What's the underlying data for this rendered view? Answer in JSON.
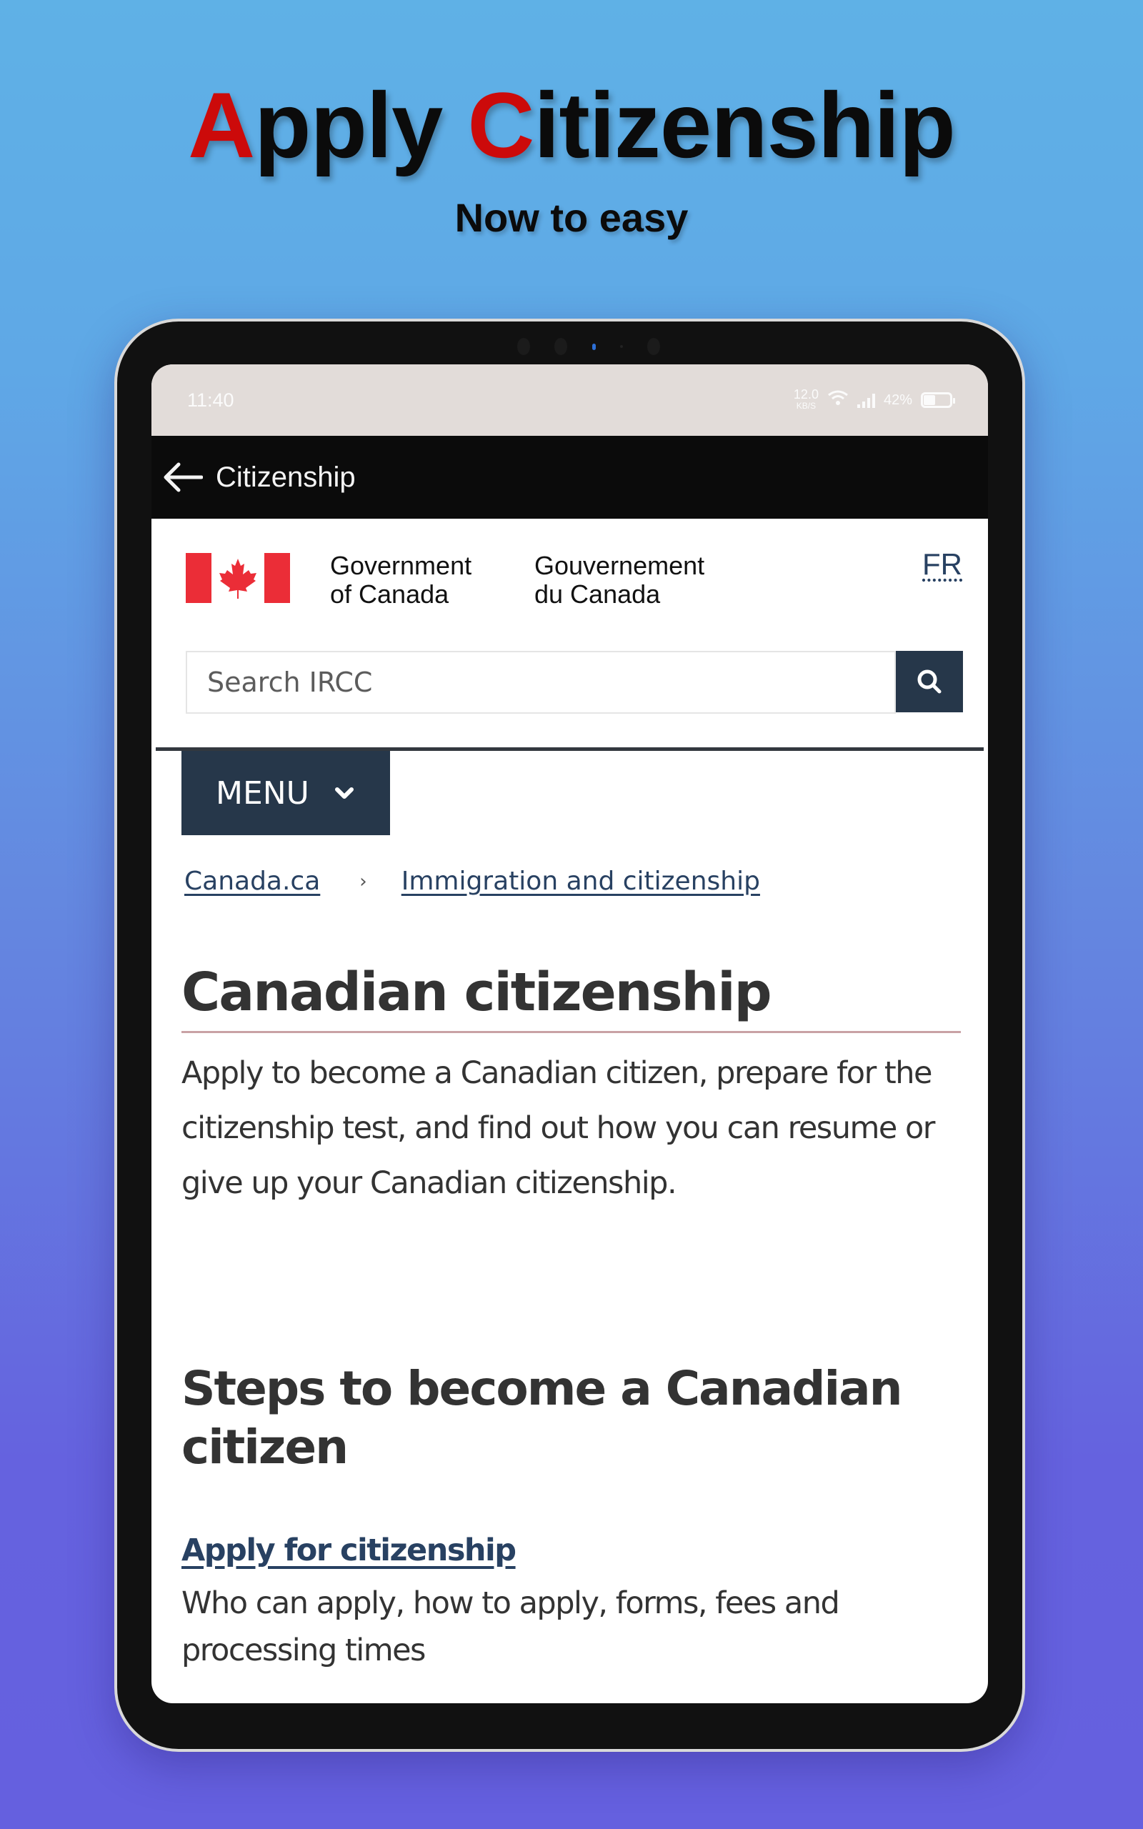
{
  "promo": {
    "title_parts": [
      {
        "text": "A",
        "accent": true
      },
      {
        "text": "pply ",
        "accent": false
      },
      {
        "text": "C",
        "accent": true
      },
      {
        "text": "itizenship",
        "accent": false
      }
    ],
    "subtitle": "Now to easy",
    "accent_color": "#cc0a0a"
  },
  "statusbar": {
    "time": "11:40",
    "net_speed": "12.0",
    "net_unit": "KB/S",
    "battery": "42%"
  },
  "appbar": {
    "back_icon": "arrow-left-icon",
    "title": "Citizenship"
  },
  "gc_header": {
    "en_line1": "Government",
    "en_line2": "of Canada",
    "fr_line1": "Gouvernement",
    "fr_line2": "du Canada",
    "language_toggle": "FR"
  },
  "search": {
    "placeholder": "Search IRCC",
    "value": "",
    "button_icon": "search-icon"
  },
  "menu": {
    "label": "MENU",
    "icon": "chevron-down-icon"
  },
  "breadcrumb": {
    "items": [
      "Canada.ca",
      "Immigration and citizenship"
    ],
    "separator": "›"
  },
  "page": {
    "title": "Canadian citizenship",
    "lead": "Apply to become a Canadian citizen, prepare for the citizenship test, and find out how you can resume or give up your Canadian citizenship.",
    "section_title": "Steps to become a Canadian citizen",
    "steps": [
      {
        "link": "Apply for citizenship",
        "description": "Who can apply, how to apply, forms, fees and processing times"
      }
    ]
  },
  "colors": {
    "gc_navy": "#26374a",
    "link": "#284162",
    "flag_red": "#eb2d37"
  }
}
